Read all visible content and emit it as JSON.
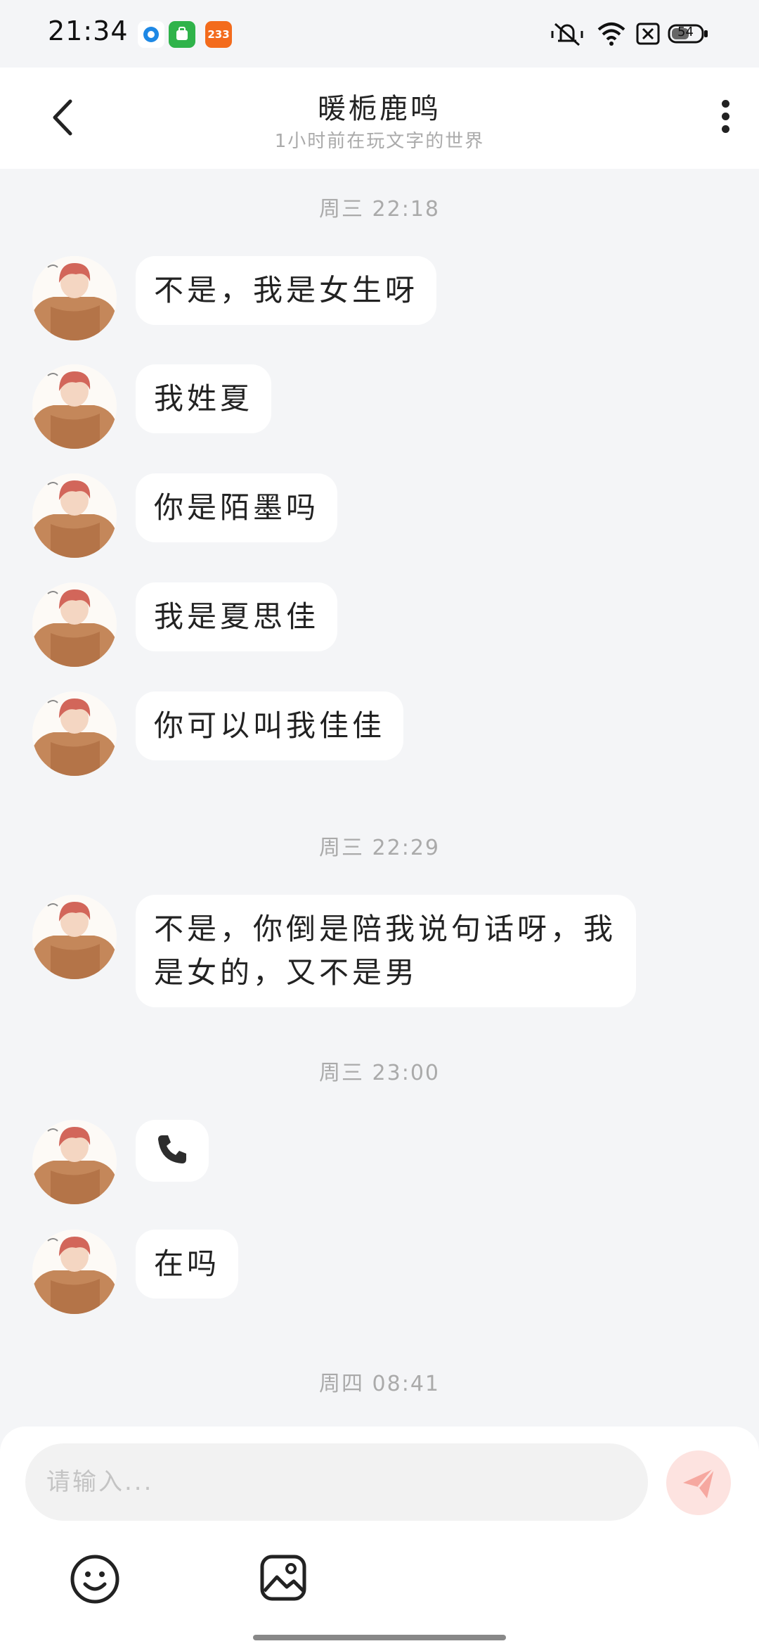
{
  "status_bar": {
    "time": "21:34",
    "app_badge_text": "233",
    "battery_level": "54"
  },
  "header": {
    "title": "暖栀鹿鸣",
    "subtitle": "1小时前在玩文字的世界"
  },
  "chat": {
    "separators": [
      "周三 22:18",
      "周三 22:29",
      "周三 23:00",
      "周四 08:41"
    ],
    "messages": [
      "不是，我是女生呀",
      "我姓夏",
      "你是陌墨吗",
      "我是夏思佳",
      "你可以叫我佳佳",
      "不是，你倒是陪我说句话呀，我是女的，又不是男",
      "在吗"
    ],
    "call_icon": "phone-icon"
  },
  "composer": {
    "placeholder": "请输入..."
  },
  "colors": {
    "background": "#f4f5f7",
    "bubble": "#ffffff",
    "send_button": "#fde3e0",
    "send_icon": "#f6a8a0"
  }
}
